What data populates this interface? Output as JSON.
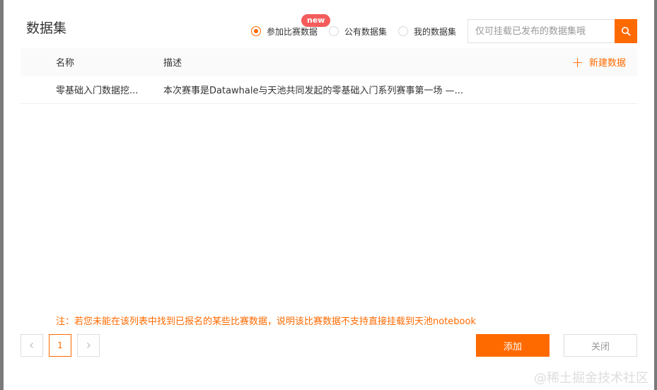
{
  "dialog": {
    "title": "数据集",
    "radios": [
      {
        "label": "参加比赛数据",
        "checked": true
      },
      {
        "label": "公有数据集",
        "checked": false
      },
      {
        "label": "我的数据集",
        "checked": false
      }
    ],
    "new_badge": "new",
    "search": {
      "placeholder": "仅可挂载已发布的数据集哦",
      "value": ""
    },
    "table": {
      "columns": [
        "名称",
        "描述"
      ],
      "new_data_label": "新建数据",
      "rows": [
        {
          "name": "零基础入门数据挖...",
          "desc": "本次赛事是Datawhale与天池共同发起的零基础入门系列赛事第一场 —..."
        }
      ]
    },
    "note": "注：若您未能在该列表中找到已报名的某些比赛数据，说明该比赛数据不支持直接挂载到天池notebook",
    "pagination": {
      "prev": "<",
      "current": "1",
      "next": ">"
    },
    "buttons": {
      "add": "添加",
      "close": "关闭"
    },
    "watermark": "@稀土掘金技术社区"
  },
  "colors": {
    "accent": "#ff6a00",
    "badge": "#f45c5c"
  }
}
